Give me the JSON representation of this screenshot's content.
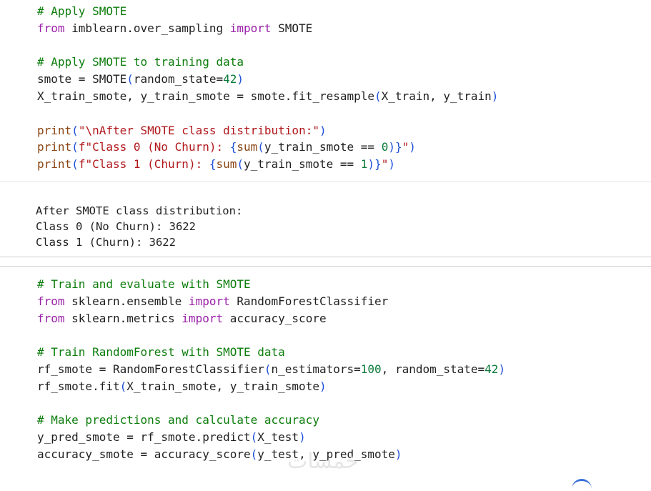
{
  "cell1": {
    "lines": [
      [
        {
          "t": "# Apply SMOTE",
          "c": "cm"
        }
      ],
      [
        {
          "t": "from",
          "c": "kw"
        },
        {
          "t": " imblearn.over_sampling ",
          "c": "ty"
        },
        {
          "t": "import",
          "c": "kw"
        },
        {
          "t": " SMOTE",
          "c": "ty"
        }
      ],
      [],
      [
        {
          "t": "# Apply SMOTE to training data",
          "c": "cm"
        }
      ],
      [
        {
          "t": "smote = SMOTE",
          "c": "ty"
        },
        {
          "t": "(",
          "c": "pr"
        },
        {
          "t": "random_state=",
          "c": "ty"
        },
        {
          "t": "42",
          "c": "nm"
        },
        {
          "t": ")",
          "c": "pr"
        }
      ],
      [
        {
          "t": "X_train_smote, y_train_smote = smote.fit_resample",
          "c": "ty"
        },
        {
          "t": "(",
          "c": "pr"
        },
        {
          "t": "X_train, y_train",
          "c": "ty"
        },
        {
          "t": ")",
          "c": "pr"
        }
      ],
      [],
      [
        {
          "t": "print",
          "c": "fn"
        },
        {
          "t": "(",
          "c": "pr"
        },
        {
          "t": "\"\\nAfter SMOTE class distribution:\"",
          "c": "st"
        },
        {
          "t": ")",
          "c": "pr"
        }
      ],
      [
        {
          "t": "print",
          "c": "fn"
        },
        {
          "t": "(",
          "c": "pr"
        },
        {
          "t": "f\"Class 0 (No Churn): ",
          "c": "st"
        },
        {
          "t": "{",
          "c": "pr"
        },
        {
          "t": "sum",
          "c": "fn"
        },
        {
          "t": "(",
          "c": "pr"
        },
        {
          "t": "y_train_smote == ",
          "c": "ty"
        },
        {
          "t": "0",
          "c": "nm"
        },
        {
          "t": ")}",
          "c": "pr"
        },
        {
          "t": "\"",
          "c": "st"
        },
        {
          "t": ")",
          "c": "pr"
        }
      ],
      [
        {
          "t": "print",
          "c": "fn"
        },
        {
          "t": "(",
          "c": "pr"
        },
        {
          "t": "f\"Class 1 (Churn): ",
          "c": "st"
        },
        {
          "t": "{",
          "c": "pr"
        },
        {
          "t": "sum",
          "c": "fn"
        },
        {
          "t": "(",
          "c": "pr"
        },
        {
          "t": "y_train_smote == ",
          "c": "ty"
        },
        {
          "t": "1",
          "c": "nm"
        },
        {
          "t": ")}",
          "c": "pr"
        },
        {
          "t": "\"",
          "c": "st"
        },
        {
          "t": ")",
          "c": "pr"
        }
      ]
    ]
  },
  "output1": {
    "lines": [
      "After SMOTE class distribution:",
      "Class 0 (No Churn): 3622",
      "Class 1 (Churn): 3622"
    ]
  },
  "cell2": {
    "lines": [
      [
        {
          "t": "# Train and evaluate with SMOTE",
          "c": "cm"
        }
      ],
      [
        {
          "t": "from",
          "c": "kw"
        },
        {
          "t": " sklearn.ensemble ",
          "c": "ty"
        },
        {
          "t": "import",
          "c": "kw"
        },
        {
          "t": " RandomForestClassifier",
          "c": "ty"
        }
      ],
      [
        {
          "t": "from",
          "c": "kw"
        },
        {
          "t": " sklearn.metrics ",
          "c": "ty"
        },
        {
          "t": "import",
          "c": "kw"
        },
        {
          "t": " accuracy_score",
          "c": "ty"
        }
      ],
      [],
      [
        {
          "t": "# Train RandomForest with SMOTE data",
          "c": "cm"
        }
      ],
      [
        {
          "t": "rf_smote = RandomForestClassifier",
          "c": "ty"
        },
        {
          "t": "(",
          "c": "pr"
        },
        {
          "t": "n_estimators=",
          "c": "ty"
        },
        {
          "t": "100",
          "c": "nm"
        },
        {
          "t": ", random_state=",
          "c": "ty"
        },
        {
          "t": "42",
          "c": "nm"
        },
        {
          "t": ")",
          "c": "pr"
        }
      ],
      [
        {
          "t": "rf_smote.fit",
          "c": "ty"
        },
        {
          "t": "(",
          "c": "pr"
        },
        {
          "t": "X_train_smote, y_train_smote",
          "c": "ty"
        },
        {
          "t": ")",
          "c": "pr"
        }
      ],
      [],
      [
        {
          "t": "# Make predictions and calculate accuracy",
          "c": "cm"
        }
      ],
      [
        {
          "t": "y_pred_smote = rf_smote.predict",
          "c": "ty"
        },
        {
          "t": "(",
          "c": "pr"
        },
        {
          "t": "X_test",
          "c": "ty"
        },
        {
          "t": ")",
          "c": "pr"
        }
      ],
      [
        {
          "t": "accuracy_smote = accuracy_score",
          "c": "ty"
        },
        {
          "t": "(",
          "c": "pr"
        },
        {
          "t": "y_test, y_pred_smote",
          "c": "ty"
        },
        {
          "t": ")",
          "c": "pr"
        }
      ]
    ]
  },
  "watermark": "خمسات"
}
